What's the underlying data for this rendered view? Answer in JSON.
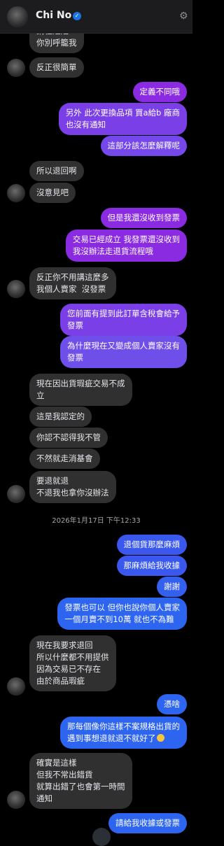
{
  "header": {
    "name": "Chi No",
    "verified_icon": "verified-badge-icon",
    "settings_icon": "gear-icon"
  },
  "messages": {
    "m0": "講種是是\n你別呼籠我",
    "m1": "反正很簡單",
    "m2": "定義不同哦",
    "m3": "另外 此次更換品項 買a給b 廠商\n也沒有通知",
    "m4": "這部分該怎麼解釋呢",
    "m5": "所以退回啊",
    "m6": "沒意見吧",
    "m7": "但是我還沒收到發票",
    "m8": "交易已經成立 我發票還沒收到\n我沒辦法走退貨流程哦",
    "m9": "反正你不用講這麼多\n我個人賣家  沒發票",
    "m10": "您前面有提到此訂單含稅會給予\n發票",
    "m11": "為什麼現在又變成個人賣家沒有\n發票",
    "m12": "現在因出貨瑕疵交易不成\n立",
    "m13": "這是我認定的",
    "m14": "你認不認得我不管",
    "m15": "不然就走消基會",
    "m16": "要退就退\n不退我也拿你沒辦法",
    "timestamp": "2026年1月17日 下午12:33",
    "m17": "退個貨那麼麻煩",
    "m18": "那麻煩給我收據",
    "m19": "謝謝",
    "m20": "發票也可以 但你也說你個人賣家\n一個月賣不到10萬 就也不為難",
    "m21": "現在我要求退回\n所以什麼都不用提供\n因為交易已不存在\n由於商品瑕疵",
    "m22": "憑啥",
    "m23": "那每個像你這樣不案規格出貨的\n遇到事想退就退不就好了",
    "m24": "確實是這樣\n但我不常出錯貨\n就算出錯了也會第一時間\n通知",
    "m25": "請給我收據或發票"
  },
  "colors": {
    "out_purple": "#8a2be2",
    "out_blue": "#2d64f0",
    "incoming": "#303030",
    "background": "#000000"
  }
}
